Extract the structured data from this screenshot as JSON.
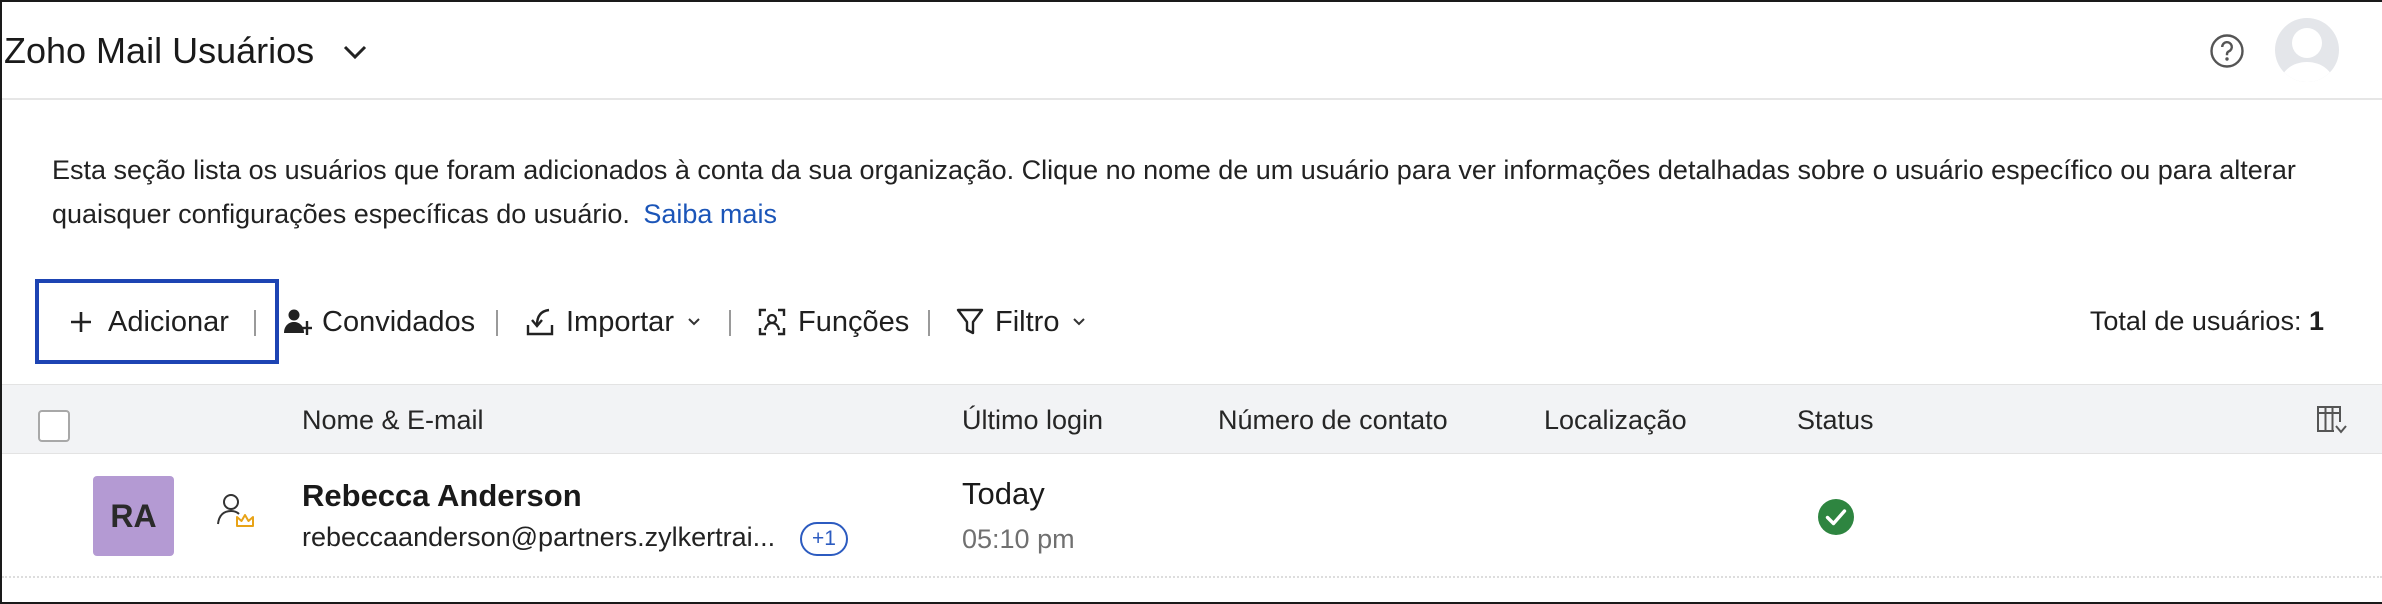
{
  "header": {
    "title": "Zoho Mail Usuários",
    "title_chevron_icon": "chevron-down-icon",
    "help_icon": "help-circle-icon",
    "avatar_icon": "user-avatar-icon"
  },
  "description": {
    "text": "Esta seção lista os usuários que foram adicionados à conta da sua organização. Clique no nome de um usuário para ver informações detalhadas sobre o usuário específico ou para alterar quaisquer configurações específicas do usuário.",
    "link": "Saiba mais"
  },
  "toolbar": {
    "add_label": "Adicionar",
    "guests_label": "Convidados",
    "import_label": "Importar",
    "roles_label": "Funções",
    "filter_label": "Filtro",
    "total_label": "Total de usuários:",
    "total_count": "1"
  },
  "table": {
    "columns": [
      "Nome & E-mail",
      "Último login",
      "Número de contato",
      "Localização",
      "Status"
    ],
    "rows": [
      {
        "initials": "RA",
        "name": "Rebecca Anderson",
        "email": "rebeccaanderson@partners.zylkertrai...",
        "email_extra": "+1",
        "last_login_day": "Today",
        "last_login_time": "05:10 pm",
        "contact": "",
        "location": "",
        "status_icon": "check-circle-icon"
      }
    ]
  },
  "colors": {
    "accent": "#1d44b3",
    "link": "#1b55b8",
    "avatar_bg": "#b49ad3",
    "status_ok": "#2e8540",
    "admin_crown": "#e8a317"
  }
}
